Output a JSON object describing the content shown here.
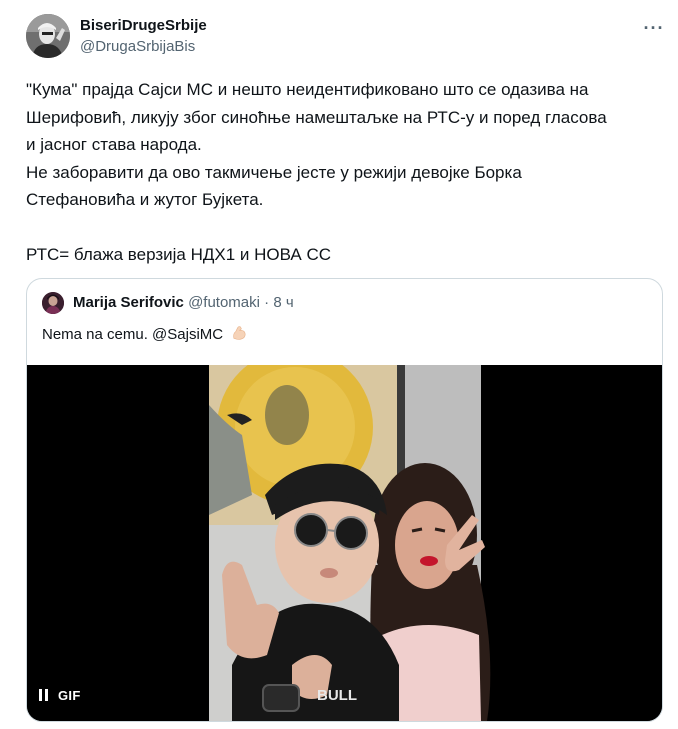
{
  "tweet": {
    "author_name": "BiseriDrugeSrbije",
    "author_handle": "@DrugaSrbijaBis",
    "more_label": "···",
    "text": "\"Кума\" прајда Сајси МС и нешто неидентификовано што се одазива на\nШерифовић, ликују због синоћње намештаљке на РТС-у и поред гласова\nи јасног става народа.\nНе заборавити да ово такмичење јесте у режији девојке Борка\nСтефановића и жутог Бујкета.\n\nРТС= блажа верзија НДХ1 и НОВА СС"
  },
  "quoted_tweet": {
    "author_name": "Marija Serifovic",
    "author_handle": "@futomaki",
    "separator": "·",
    "time": "8 ч",
    "text": "Nema na cemu. @SajsiMC",
    "emoji": "flexed-biceps-icon",
    "media": {
      "type": "gif",
      "badge_label": "GIF",
      "state": "playing",
      "shirt_text": "BULL"
    }
  },
  "colors": {
    "text_primary": "#0f1419",
    "text_secondary": "#536471",
    "border": "#cfd9de",
    "media_background": "#000000"
  }
}
